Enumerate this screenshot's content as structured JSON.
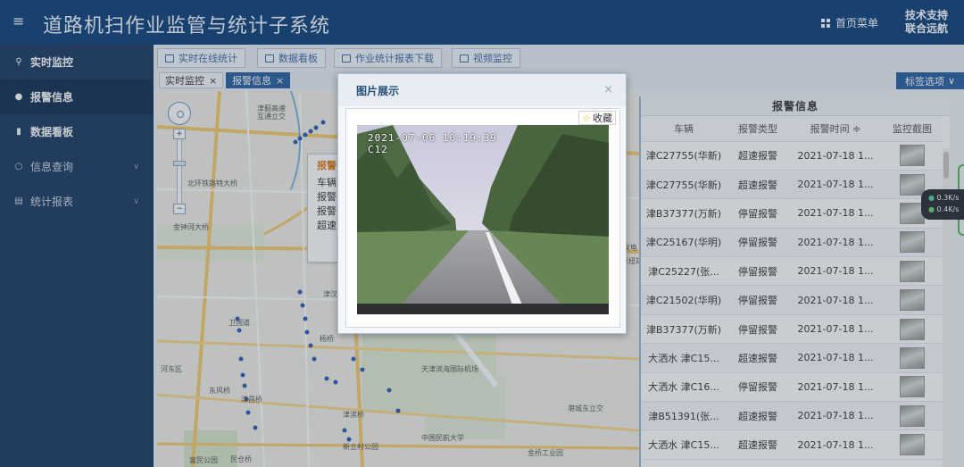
{
  "header": {
    "title": "道路机扫作业监管与统计子系统",
    "home_menu": "首页菜单",
    "support_line1": "技术支持",
    "support_line2": "联合远航"
  },
  "sidebar": {
    "items": [
      {
        "label": "实时监控",
        "icon": "location-pin-icon"
      },
      {
        "label": "报警信息",
        "icon": "bulb-icon"
      },
      {
        "label": "数据看板",
        "icon": "bar-chart-icon"
      },
      {
        "label": "信息查询",
        "icon": "search-icon"
      },
      {
        "label": "统计报表",
        "icon": "report-icon"
      }
    ]
  },
  "toolbar": {
    "buttons": [
      "实时在线统计",
      "数据看板",
      "作业统计报表下载",
      "视频监控"
    ]
  },
  "tabs": {
    "items": [
      "实时监控",
      "报警信息"
    ],
    "select_label": "标签选项"
  },
  "map": {
    "labels": [
      "津蓟高速",
      "互通立交",
      "北环铁路特大桥",
      "金钟河大桥",
      "津汉",
      "卫国道",
      "东风桥",
      "杨桥",
      "河东区",
      "津昌桥",
      "津滨桥",
      "天津滨海国际机场",
      "中国民航大学",
      "港城东立交",
      "新立村公园",
      "金桥工业园",
      "富民公园",
      "民仓桥",
      "家电",
      "枢纽站"
    ],
    "popup": {
      "title": "报警",
      "lines": [
        "车辆",
        "报警",
        "报警",
        "超速"
      ]
    }
  },
  "alarm_panel": {
    "title": "报警信息",
    "columns": [
      "车辆",
      "报警类型",
      "报警时间 ≑",
      "监控截图"
    ],
    "rows": [
      {
        "vehicle": "津C27755(华新)",
        "type": "超速报警",
        "time": "2021-07-18 1..."
      },
      {
        "vehicle": "津C27755(华新)",
        "type": "超速报警",
        "time": "2021-07-18 1..."
      },
      {
        "vehicle": "津B37377(万新)",
        "type": "停留报警",
        "time": "2021-07-18 1..."
      },
      {
        "vehicle": "津C25167(华明)",
        "type": "停留报警",
        "time": "2021-07-18 1..."
      },
      {
        "vehicle": "津C25227(张...",
        "type": "停留报警",
        "time": "2021-07-18 1..."
      },
      {
        "vehicle": "津C21502(华明)",
        "type": "停留报警",
        "time": "2021-07-18 1..."
      },
      {
        "vehicle": "津B37377(万新)",
        "type": "停留报警",
        "time": "2021-07-18 1..."
      },
      {
        "vehicle": "大洒水 津C15...",
        "type": "超速报警",
        "time": "2021-07-18 1..."
      },
      {
        "vehicle": "大洒水 津C16...",
        "type": "停留报警",
        "time": "2021-07-18 1..."
      },
      {
        "vehicle": "津B51391(张...",
        "type": "超速报警",
        "time": "2021-07-18 1..."
      },
      {
        "vehicle": "大洒水 津C15...",
        "type": "超速报警",
        "time": "2021-07-18 1..."
      }
    ]
  },
  "speed_widget": {
    "up": "0.3",
    "down": "0.4",
    "unit": "K/s"
  },
  "modal": {
    "title": "图片展示",
    "close": "×",
    "favorite": "收藏",
    "timestamp": "2021-07-06 10:19:39",
    "channel": "C12"
  },
  "colors": {
    "header_bg": "#0c3e78",
    "sidebar_bg": "#17375d",
    "accent": "#245c9c",
    "popup_title": "#e07b1b"
  }
}
